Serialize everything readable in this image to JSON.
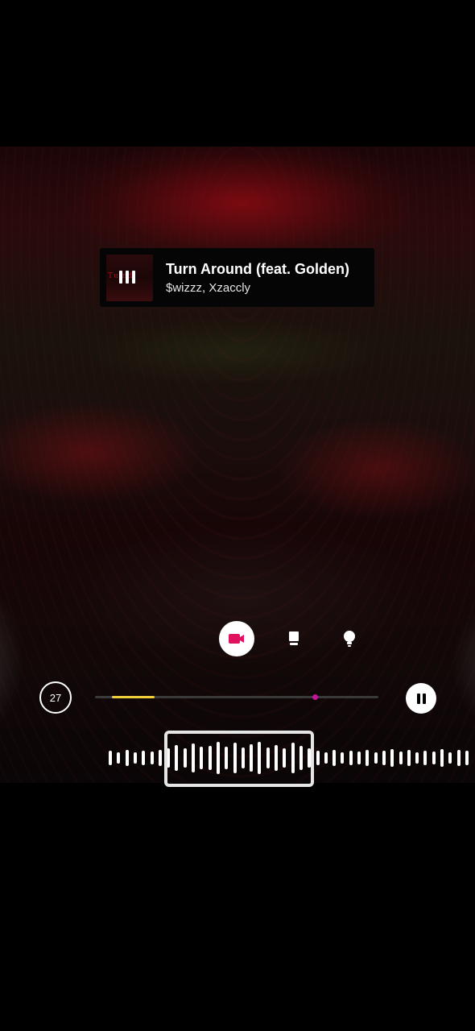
{
  "music_sticker": {
    "title": "Turn Around (feat. Golden)",
    "artist": "$wizzz, Xzaccly",
    "playing_icon": "equalizer-bars-icon"
  },
  "style_selector": {
    "options": [
      {
        "icon": "video-camera-icon",
        "selected": true
      },
      {
        "icon": "album-card-icon",
        "selected": false
      },
      {
        "icon": "lightbulb-icon",
        "selected": false
      }
    ],
    "accent_color": "#e0115f"
  },
  "clip": {
    "duration_label": "27",
    "playback_icon": "pause-icon",
    "selection_color": "#f1cf3c",
    "marker_color": "#c0169a"
  }
}
